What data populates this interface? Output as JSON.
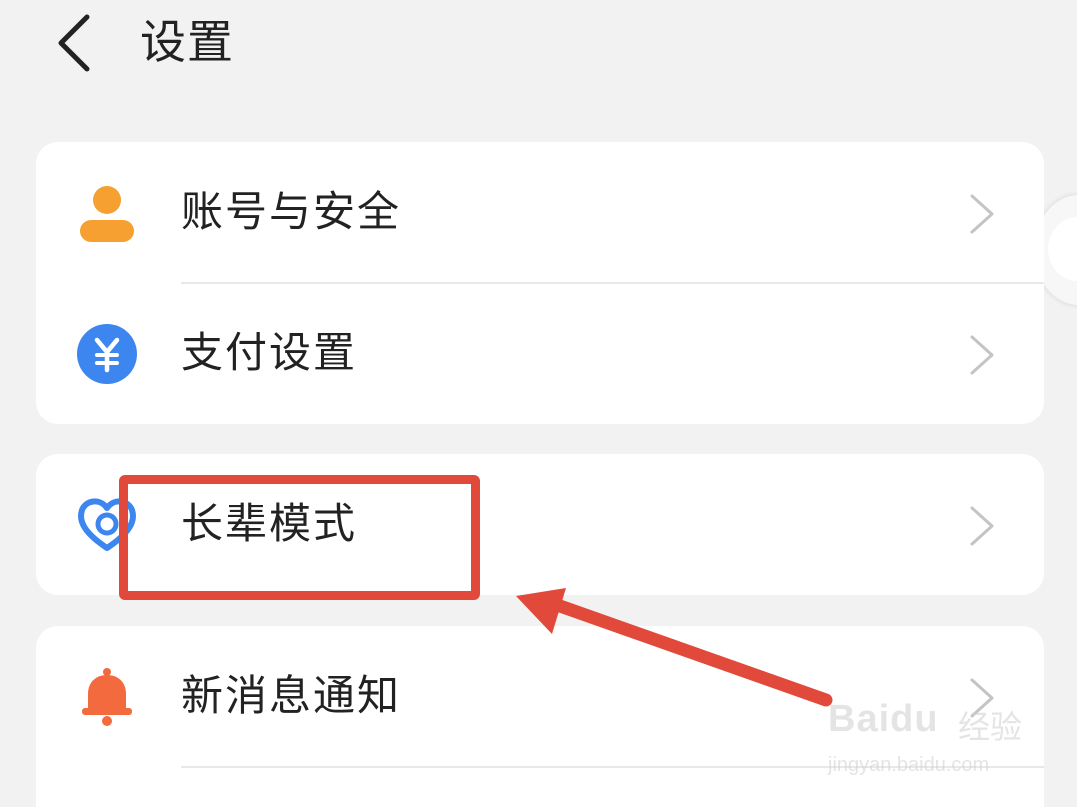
{
  "header": {
    "title": "设置",
    "back_icon": "chevron-left-icon"
  },
  "menu": {
    "group1": [
      {
        "label": "账号与安全",
        "icon": "user-icon",
        "icon_color": "#f5a030"
      },
      {
        "label": "支付设置",
        "icon": "yuan-coin-icon",
        "icon_color": "#3d86f0"
      }
    ],
    "group2": [
      {
        "label": "长辈模式",
        "icon": "heart-icon",
        "icon_color": "#3d86f0"
      }
    ],
    "group3": [
      {
        "label": "新消息通知",
        "icon": "bell-icon",
        "icon_color": "#f26a3d"
      }
    ]
  },
  "annotation": {
    "color": "#e14a3b",
    "highlight_target": "长辈模式"
  },
  "watermark": {
    "brand": "Baidu",
    "brand_cn": "经验",
    "url": "jingyan.baidu.com"
  },
  "colors": {
    "background": "#f2f2f2",
    "card": "#ffffff",
    "chevron": "#c4c4c4"
  }
}
